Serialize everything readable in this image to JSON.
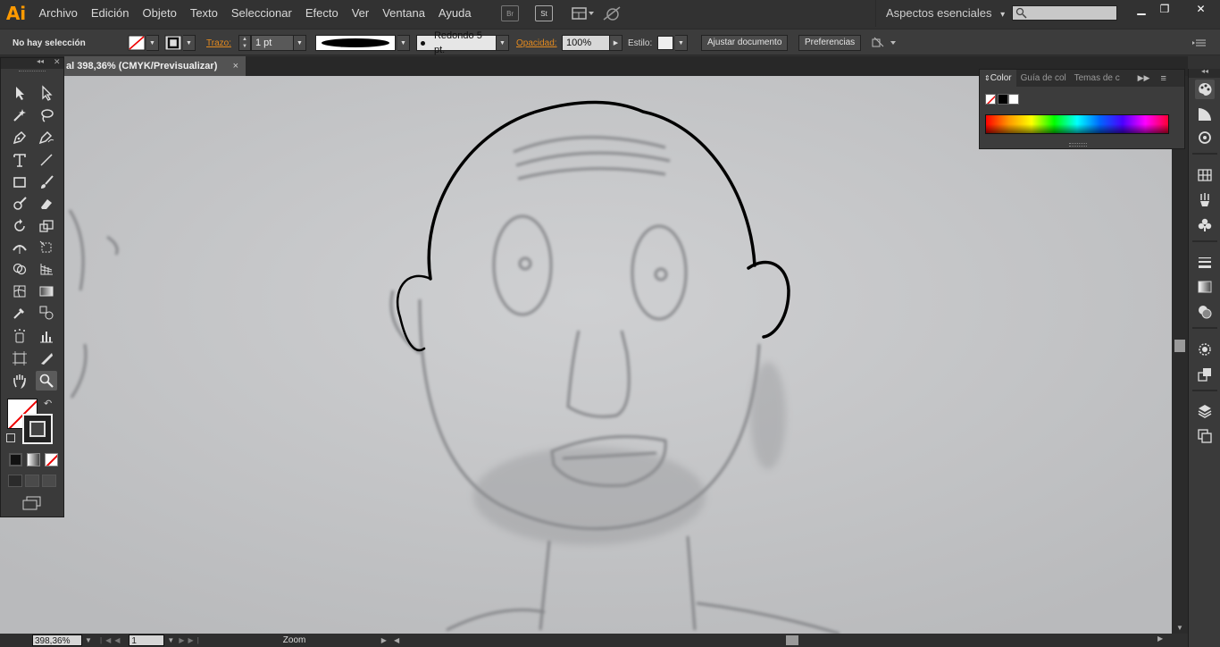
{
  "app": {
    "logo": "Ai"
  },
  "menu": [
    "Archivo",
    "Edición",
    "Objeto",
    "Texto",
    "Seleccionar",
    "Efecto",
    "Ver",
    "Ventana",
    "Ayuda"
  ],
  "menubar_icons": {
    "bridge": "Br",
    "stock": "St"
  },
  "workspace": {
    "label": "Aspectos esenciales",
    "arrow": "▾"
  },
  "search": {
    "placeholder": ""
  },
  "window_controls": {
    "minimize": "▁",
    "restore": "❐",
    "close": "✕"
  },
  "control": {
    "selection": "No hay selección",
    "stroke_label": "Trazo:",
    "stroke_value": "1 pt",
    "brush_label": "Redondo 5 pt.",
    "opacity_label": "Opacidad:",
    "opacity_value": "100%",
    "style_label": "Estilo:",
    "adjust_doc": "Ajustar documento",
    "preferences": "Preferencias"
  },
  "document": {
    "tab_title": "al 398,36% (CMYK/Previsualizar)",
    "close": "×"
  },
  "status": {
    "zoom": "398,36%",
    "artboard": "1",
    "mode": "Zoom"
  },
  "color_panel": {
    "tabs": [
      "Color",
      "Guía de col",
      "Temas de c"
    ],
    "menu": "≡"
  },
  "tools_panel": {
    "collapse": "◂◂",
    "close": "✕"
  },
  "colors": {
    "accent": "#ff9a00",
    "ui_dark": "#323232",
    "canvas": "#c4c5c7"
  },
  "icons": {
    "tools": [
      "selection-tool",
      "direct-selection-tool",
      "magic-wand-tool",
      "lasso-tool",
      "pen-tool",
      "curvature-tool",
      "type-tool",
      "line-tool",
      "rectangle-tool",
      "paintbrush-tool",
      "shaper-tool",
      "eraser-tool",
      "rotate-tool",
      "scale-tool",
      "width-tool",
      "free-transform-tool",
      "shape-builder-tool",
      "perspective-grid-tool",
      "mesh-tool",
      "gradient-tool",
      "eyedropper-tool",
      "blend-tool",
      "symbol-sprayer-tool",
      "column-graph-tool",
      "artboard-tool",
      "slice-tool",
      "hand-tool",
      "zoom-tool"
    ]
  }
}
